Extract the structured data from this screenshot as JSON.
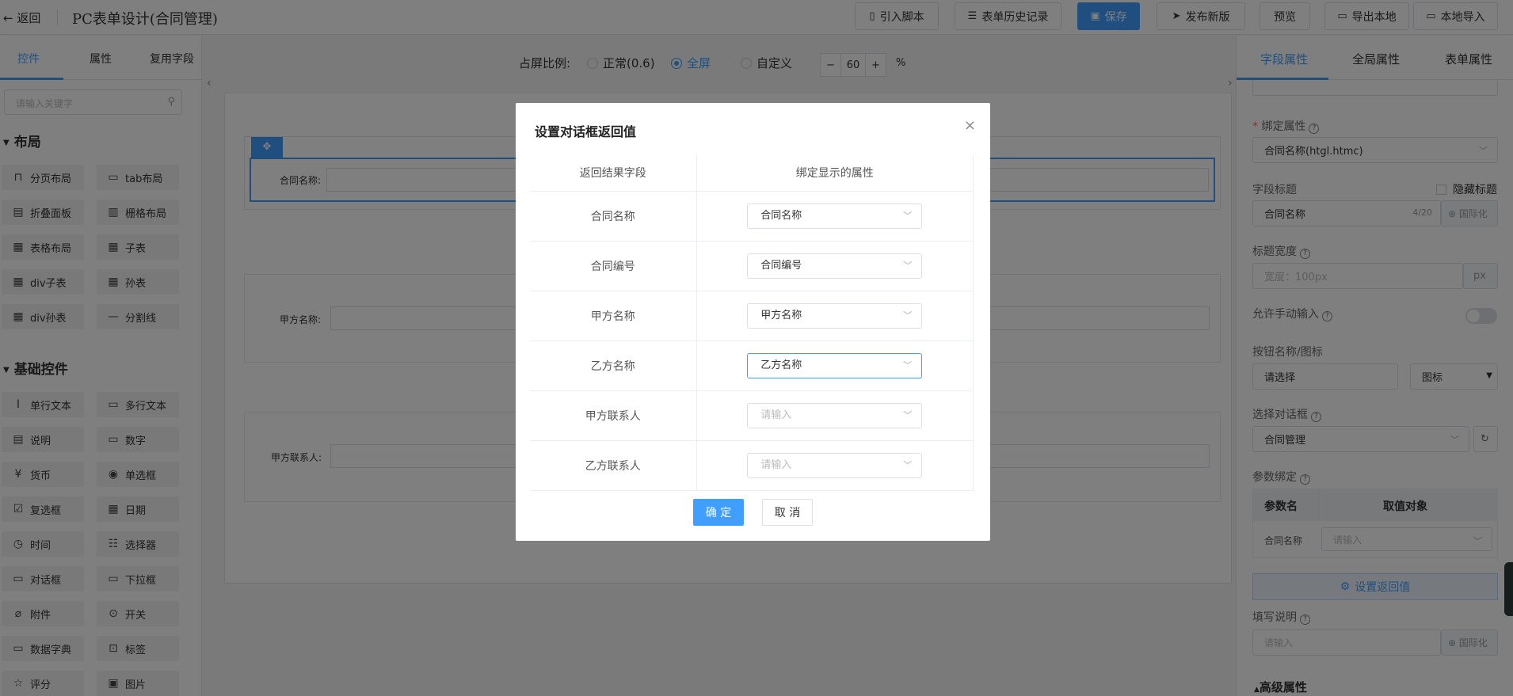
{
  "topbar": {
    "back_label": "返回",
    "title": "PC表单设计(合同管理)",
    "buttons": {
      "import_script": "引入脚本",
      "history": "表单历史记录",
      "save": "保存",
      "publish": "发布新版",
      "preview": "预览",
      "export": "导出本地",
      "import_local": "本地导入"
    }
  },
  "left": {
    "tabs": [
      "控件",
      "属性",
      "复用字段"
    ],
    "search_placeholder": "请输入关键字",
    "layout_section": "布局",
    "layout_items": [
      "分页布局",
      "tab布局",
      "折叠面板",
      "栅格布局",
      "表格布局",
      "子表",
      "div子表",
      "孙表",
      "div孙表",
      "分割线"
    ],
    "basic_section": "基础控件",
    "basic_items": [
      "单行文本",
      "多行文本",
      "说明",
      "数字",
      "货币",
      "单选框",
      "复选框",
      "日期",
      "时间",
      "选择器",
      "对话框",
      "下拉框",
      "附件",
      "开关",
      "数据字典",
      "标签",
      "评分",
      "图片"
    ]
  },
  "center": {
    "ratio_label": "占屏比例:",
    "options": [
      "正常(0.6)",
      "全屏",
      "自定义"
    ],
    "selected_option": "全屏",
    "zoom_minus": "−",
    "zoom_value": "60",
    "zoom_plus": "+",
    "zoom_unit": "%",
    "fields": [
      "合同名称:",
      "甲方名称:",
      "甲方联系人:"
    ]
  },
  "right": {
    "tabs": [
      "字段属性",
      "全局属性",
      "表单属性"
    ],
    "bind_attr_label": "绑定属性",
    "bind_attr_value": "合同名称(htgl.htmc)",
    "field_title_label": "字段标题",
    "hide_title_label": "隐藏标题",
    "field_title_value": "合同名称",
    "field_title_count": "4/20",
    "i18n_label": "国际化",
    "title_width_label": "标题宽度",
    "title_width_placeholder": "宽度：100px",
    "title_width_unit": "px",
    "allow_manual_label": "允许手动输入",
    "button_name_label": "按钮名称/图标",
    "button_name_value": "请选择",
    "icon_label": "图标",
    "select_dialog_label": "选择对话框",
    "select_dialog_value": "合同管理",
    "param_bind_label": "参数绑定",
    "param_headers": [
      "参数名",
      "取值对象"
    ],
    "param_row_name": "合同名称",
    "param_row_placeholder": "请输入",
    "set_return_label": "设置返回值",
    "fill_desc_label": "填写说明",
    "fill_desc_placeholder": "请输入",
    "advanced_label": "高级属性"
  },
  "dialog": {
    "title": "设置对话框返回值",
    "close": "×",
    "headers": [
      "返回结果字段",
      "绑定显示的属性"
    ],
    "rows": [
      {
        "field": "合同名称",
        "value": "合同名称"
      },
      {
        "field": "合同编号",
        "value": "合同编号"
      },
      {
        "field": "甲方名称",
        "value": "甲方名称"
      },
      {
        "field": "乙方名称",
        "value": "乙方名称"
      },
      {
        "field": "甲方联系人",
        "value": ""
      },
      {
        "field": "乙方联系人",
        "value": ""
      }
    ],
    "placeholder": "请输入",
    "confirm": "确 定",
    "cancel": "取 消"
  },
  "colors": {
    "primary": "#409eff",
    "overlay": "rgba(0,0,0,0.5)"
  }
}
